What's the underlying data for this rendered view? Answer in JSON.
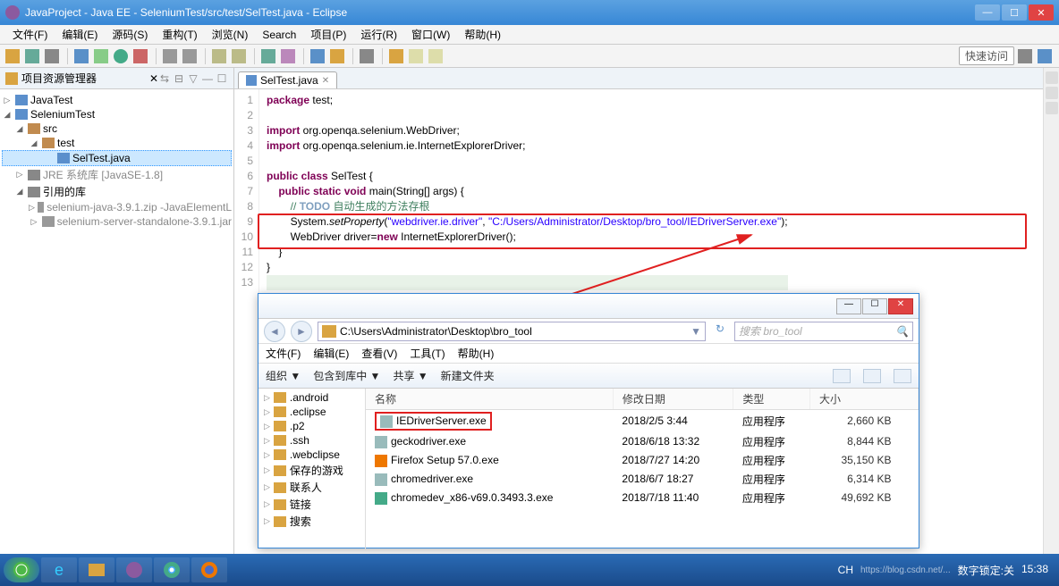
{
  "window": {
    "title": "JavaProject - Java EE - SeleniumTest/src/test/SelTest.java - Eclipse"
  },
  "menu": [
    "文件(F)",
    "编辑(E)",
    "源码(S)",
    "重构(T)",
    "浏览(N)",
    "Search",
    "项目(P)",
    "运行(R)",
    "窗口(W)",
    "帮助(H)"
  ],
  "quick_access": "快速访问",
  "explorer": {
    "title": "项目资源管理器",
    "items": [
      {
        "toggle": "▷",
        "icon": "ico-java",
        "label": "JavaTest",
        "indent": 0
      },
      {
        "toggle": "◢",
        "icon": "ico-java",
        "label": "SeleniumTest",
        "indent": 0
      },
      {
        "toggle": "◢",
        "icon": "ico-pkg",
        "label": "src",
        "indent": 1
      },
      {
        "toggle": "◢",
        "icon": "ico-pkg",
        "label": "test",
        "indent": 2
      },
      {
        "toggle": "",
        "icon": "ico-java",
        "label": "SelTest.java",
        "indent": 3,
        "selected": true
      },
      {
        "toggle": "▷",
        "icon": "ico-lib",
        "label": "JRE 系统库 [JavaSE-1.8]",
        "indent": 1,
        "grey": true
      },
      {
        "toggle": "◢",
        "icon": "ico-lib",
        "label": "引用的库",
        "indent": 1
      },
      {
        "toggle": "▷",
        "icon": "ico-jar",
        "label": "selenium-java-3.9.1.zip -JavaElementL",
        "indent": 2,
        "grey": true
      },
      {
        "toggle": "▷",
        "icon": "ico-jar",
        "label": "selenium-server-standalone-3.9.1.jar",
        "indent": 2,
        "grey": true
      }
    ]
  },
  "editor_tab": "SelTest.java",
  "code_lines": [
    {
      "n": "1",
      "html": "<span class='kw'>package</span> test;"
    },
    {
      "n": "2",
      "html": ""
    },
    {
      "n": "3",
      "marker": "⊖",
      "html": "<span class='kw'>import</span> org.openqa.selenium.WebDriver;"
    },
    {
      "n": "4",
      "html": "<span class='kw'>import</span> org.openqa.selenium.ie.InternetExplorerDriver;"
    },
    {
      "n": "5",
      "html": ""
    },
    {
      "n": "6",
      "html": "<span class='kw'>public class</span> SelTest {"
    },
    {
      "n": "7",
      "marker": "⊖",
      "html": "    <span class='kw'>public static void</span> main(String[] args) {"
    },
    {
      "n": "8",
      "html": "        <span class='cmt'>// </span><span class='cmt-tag'>TODO</span><span class='cmt'> 自动生成的方法存根</span>"
    },
    {
      "n": "9",
      "html": "        System.<span class='itl'>setProperty</span>(<span class='str'>\"webdriver.ie.driver\"</span>, <span class='str'>\"C:/Users/Administrator/Desktop/bro_tool/IEDriverServer.exe\"</span>);"
    },
    {
      "n": "10",
      "html": "        WebDriver driver=<span class='kw'>new</span> InternetExplorerDriver();"
    },
    {
      "n": "11",
      "html": "    }"
    },
    {
      "n": "12",
      "html": "}"
    },
    {
      "n": "13",
      "html": "",
      "highlight": true
    }
  ],
  "fexplorer": {
    "path": "C:\\Users\\Administrator\\Desktop\\bro_tool",
    "search_placeholder": "搜索 bro_tool",
    "menu": [
      "文件(F)",
      "编辑(E)",
      "查看(V)",
      "工具(T)",
      "帮助(H)"
    ],
    "org": [
      "组织 ▼",
      "包含到库中 ▼",
      "共享 ▼",
      "新建文件夹"
    ],
    "tree": [
      ".android",
      ".eclipse",
      ".p2",
      ".ssh",
      ".webclipse",
      "保存的游戏",
      "联系人",
      "链接",
      "搜索"
    ],
    "columns": [
      "名称",
      "修改日期",
      "类型",
      "大小"
    ],
    "files": [
      {
        "name": "IEDriverServer.exe",
        "date": "2018/2/5 3:44",
        "type": "应用程序",
        "size": "2,660 KB",
        "ico": "exe",
        "boxed": true
      },
      {
        "name": "geckodriver.exe",
        "date": "2018/6/18 13:32",
        "type": "应用程序",
        "size": "8,844 KB",
        "ico": "exe"
      },
      {
        "name": "Firefox Setup 57.0.exe",
        "date": "2018/7/27 14:20",
        "type": "应用程序",
        "size": "35,150 KB",
        "ico": "ff"
      },
      {
        "name": "chromedriver.exe",
        "date": "2018/6/7 18:27",
        "type": "应用程序",
        "size": "6,314 KB",
        "ico": "exe"
      },
      {
        "name": "chromedev_x86-v69.0.3493.3.exe",
        "date": "2018/7/18 11:40",
        "type": "应用程序",
        "size": "49,692 KB",
        "ico": "ch"
      }
    ]
  },
  "tray": {
    "ime": "CH",
    "numlock": "数字锁定:关",
    "time": "15:38",
    "watermark": "https://blog.csdn.net/..."
  }
}
